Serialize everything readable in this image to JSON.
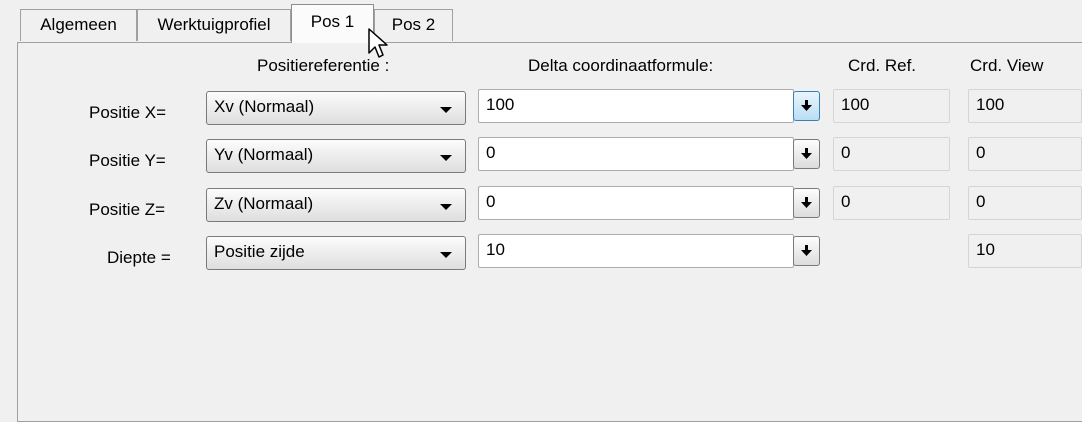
{
  "tabs": [
    {
      "label": "Algemeen"
    },
    {
      "label": "Werktuigprofiel"
    },
    {
      "label": "Pos 1"
    },
    {
      "label": "Pos 2"
    }
  ],
  "headers": {
    "position_reference": "Positiereferentie :",
    "delta_formula": "Delta coordinaatformule:",
    "crd_ref": "Crd. Ref.",
    "crd_view": "Crd. View"
  },
  "rows": [
    {
      "label": "Positie X=",
      "reference": "Xv (Normaal)",
      "formula": "100",
      "crd_ref": "100",
      "crd_view": "100"
    },
    {
      "label": "Positie Y=",
      "reference": "Yv (Normaal)",
      "formula": "0",
      "crd_ref": "0",
      "crd_view": "0"
    },
    {
      "label": "Positie Z=",
      "reference": "Zv (Normaal)",
      "formula": "0",
      "crd_ref": "0",
      "crd_view": "0"
    },
    {
      "label": "Diepte =",
      "reference": "Positie zijde",
      "formula": "10",
      "crd_ref": "",
      "crd_view": "10"
    }
  ],
  "icons": {
    "formula_button": "arrow-down-icon",
    "mouse_cursor": "cursor-icon"
  },
  "active_tab": "Pos 1"
}
